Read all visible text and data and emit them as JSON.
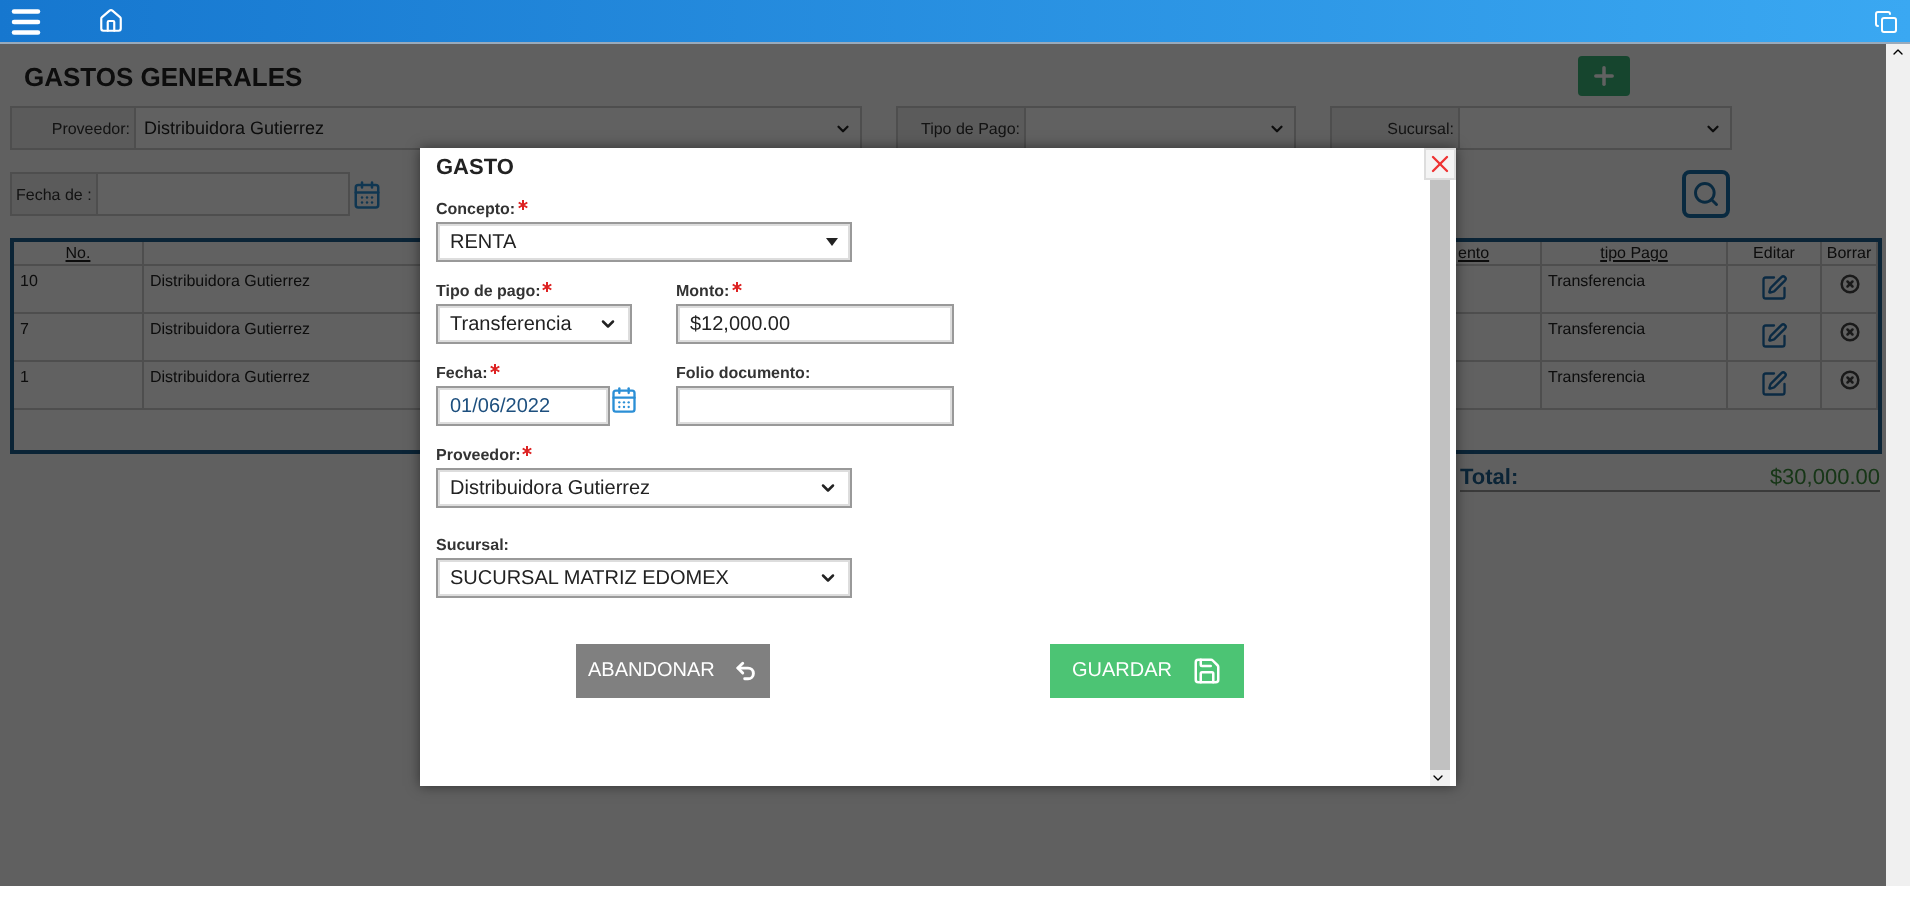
{
  "page": {
    "title": "GASTOS GENERALES"
  },
  "filters": [
    {
      "label": "Proveedor:",
      "value": "Distribuidora Gutierrez"
    },
    {
      "label": "Tipo de Pago:"
    },
    {
      "label": "Sucursal:"
    }
  ],
  "date_filter": {
    "label": "Fecha de :"
  },
  "table": {
    "columns": [
      "No.",
      "ento",
      "tipo Pago",
      "Editar",
      "Borrar"
    ],
    "rows": [
      {
        "no": "10",
        "proveedor": "Distribuidora Gutierrez",
        "tipo_pago": "Transferencia"
      },
      {
        "no": "7",
        "proveedor": "Distribuidora Gutierrez",
        "tipo_pago": "Transferencia"
      },
      {
        "no": "1",
        "proveedor": "Distribuidora Gutierrez",
        "tipo_pago": "Transferencia"
      }
    ],
    "total_label": "Total:",
    "total": "$30,000.00"
  },
  "modal": {
    "title": "GASTO",
    "rows": [
      [
        {
          "kind": "combo",
          "label": "Concepto:",
          "required": true,
          "value": "RENTA"
        }
      ],
      [
        {
          "kind": "select",
          "label": "Tipo de pago:",
          "required": true,
          "value": "Transferencia"
        },
        {
          "kind": "input",
          "label": "Monto:",
          "required": true,
          "value": "$12,000.00"
        }
      ],
      [
        {
          "kind": "date",
          "label": "Fecha:",
          "required": true,
          "value": "01/06/2022"
        },
        {
          "kind": "input",
          "label": "Folio documento:",
          "required": false
        }
      ],
      [
        {
          "kind": "select",
          "label": "Proveedor:",
          "required": true,
          "value": "Distribuidora Gutierrez"
        }
      ],
      [
        {
          "kind": "select",
          "label": "Sucursal:",
          "required": false,
          "value": "SUCURSAL MATRIZ EDOMEX"
        }
      ]
    ],
    "buttons": [
      {
        "kind": "cancel",
        "label": "ABANDONAR"
      },
      {
        "kind": "save",
        "label": "GUARDAR"
      }
    ]
  }
}
